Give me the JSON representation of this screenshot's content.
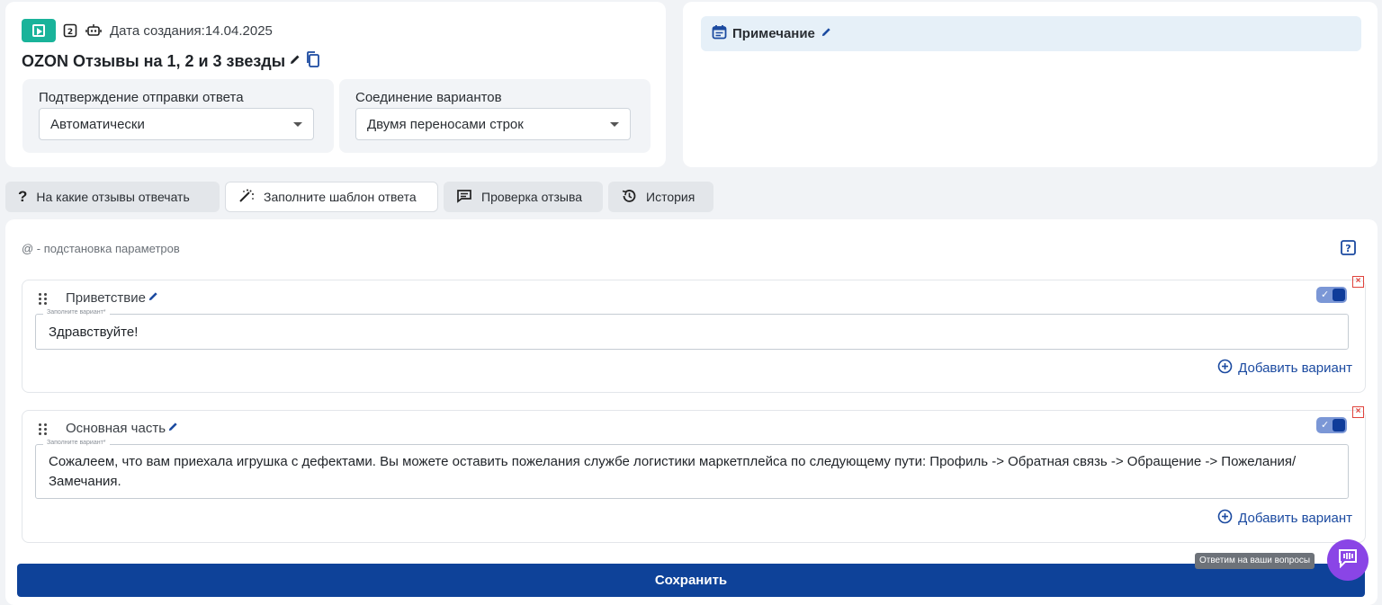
{
  "header": {
    "date_label": "Дата создания:14.04.2025",
    "title": "OZON Отзывы на 1, 2 и 3 звезды"
  },
  "settings": {
    "confirm": {
      "label": "Подтверждение отправки ответа",
      "value": "Автоматически"
    },
    "join": {
      "label": "Соединение вариантов",
      "value": "Двумя переносами строк"
    }
  },
  "note": {
    "label": "Примечание"
  },
  "tabs": [
    {
      "label": "На какие отзывы отвечать",
      "icon": "question-icon"
    },
    {
      "label": "Заполните шаблон ответа",
      "icon": "magic-wand-icon",
      "active": true
    },
    {
      "label": "Проверка отзыва",
      "icon": "message-icon"
    },
    {
      "label": "История",
      "icon": "history-icon"
    }
  ],
  "template": {
    "hint": "@ - подстановка параметров",
    "blocks": [
      {
        "title": "Приветствие",
        "field_label": "Заполните вариант*",
        "value": "Здравствуйте!",
        "add_label": "Добавить вариант",
        "enabled": true
      },
      {
        "title": "Основная часть",
        "field_label": "Заполните вариант*",
        "value": "Сожалеем, что вам приехала игрушка с дефектами. Вы можете оставить пожелания службе логистики маркетплейса по следующему пути: Профиль -> Обратная связь -> Обращение -> Пожелания/Замечания.",
        "add_label": "Добавить вариант",
        "enabled": true
      }
    ]
  },
  "save_label": "Сохранить",
  "chat": {
    "tooltip": "Ответим на ваши вопросы"
  },
  "colors": {
    "accent": "#0e4299",
    "play": "#19b39a",
    "chat": "#8a45e6",
    "delete": "#e0433c"
  }
}
